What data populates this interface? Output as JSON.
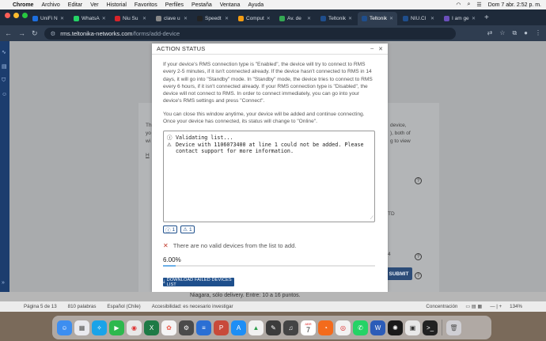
{
  "menubar": {
    "items": [
      "Chrome",
      "Archivo",
      "Editar",
      "Ver",
      "Historial",
      "Favoritos",
      "Perfiles",
      "Pestaña",
      "Ventana",
      "Ayuda"
    ],
    "clock": "Dom 7 abr.  2:52 p. m."
  },
  "tabs": [
    {
      "label": "UniFi N",
      "color": "#1d6fe0"
    },
    {
      "label": "WhatsA",
      "color": "#25d366"
    },
    {
      "label": "Niu Su",
      "color": "#d8232a"
    },
    {
      "label": "clave u",
      "color": "#888888"
    },
    {
      "label": "Speedt",
      "color": "#222222"
    },
    {
      "label": "Comput",
      "color": "#f39c12"
    },
    {
      "label": "Av. de",
      "color": "#34a853"
    },
    {
      "label": "Teltonik",
      "color": "#1f4e8c"
    },
    {
      "label": "Teltonik",
      "color": "#1f4e8c",
      "active": true
    },
    {
      "label": "NIU.Cl",
      "color": "#1f4e8c"
    },
    {
      "label": "I am ge",
      "color": "#6b4fbb"
    }
  ],
  "address": {
    "host": "rms.teltonika-networks.com",
    "path": "/forms/add-device"
  },
  "background": {
    "left_fragments": [
      "Th",
      "yo",
      "wi",
      "H"
    ],
    "right_fragments": [
      "device,",
      "), both of",
      "g to view"
    ],
    "model_label": "TD",
    "quantity": "4",
    "submit": "SUBMIT"
  },
  "modal": {
    "title": "ACTION STATUS",
    "paragraph1": "If your device's RMS connection type is \"Enabled\", the device will try to connect to RMS every 2-5 minutes, if it isn't connected already. If the device hasn't connected to RMS in 14 days, it will go into \"Standby\" mode. In \"Standby\" mode, the device tries to connect to RMS every 6 hours, if it isn't connected already. If your RMS connection type is \"Disabled\", the device will not connect to RMS. In order to connect immediately, you can go into your device's RMS settings and press \"Connect\".",
    "paragraph2": "You can close this window anytime, your device will be added and continue connecting. Once your device has connected, its status will change to \"Online\".",
    "log_line1": "Validating list...",
    "log_line2": "Device with 1106073400 at line 1 could not be added. Please contact support for more information.",
    "counter_info": "1",
    "counter_warning": "1",
    "notice": "There are no valid devices from the list to add.",
    "percent_text": "6.00%",
    "progress": 0.06,
    "download_button": "DOWNLOAD FAILED DEVICES LIST"
  },
  "word": {
    "doc_line": "Niagara, sólo delivery. Entre: 10 a 16 puntos.",
    "page": "Página 5 de 13",
    "words": "810 palabras",
    "language": "Español (Chile)",
    "accessibility": "Accesibilidad: es necesario investigar",
    "focus": "Concentración",
    "zoom": "134%"
  },
  "dock": {
    "calendar_month": "ABR",
    "calendar_day": "7"
  }
}
